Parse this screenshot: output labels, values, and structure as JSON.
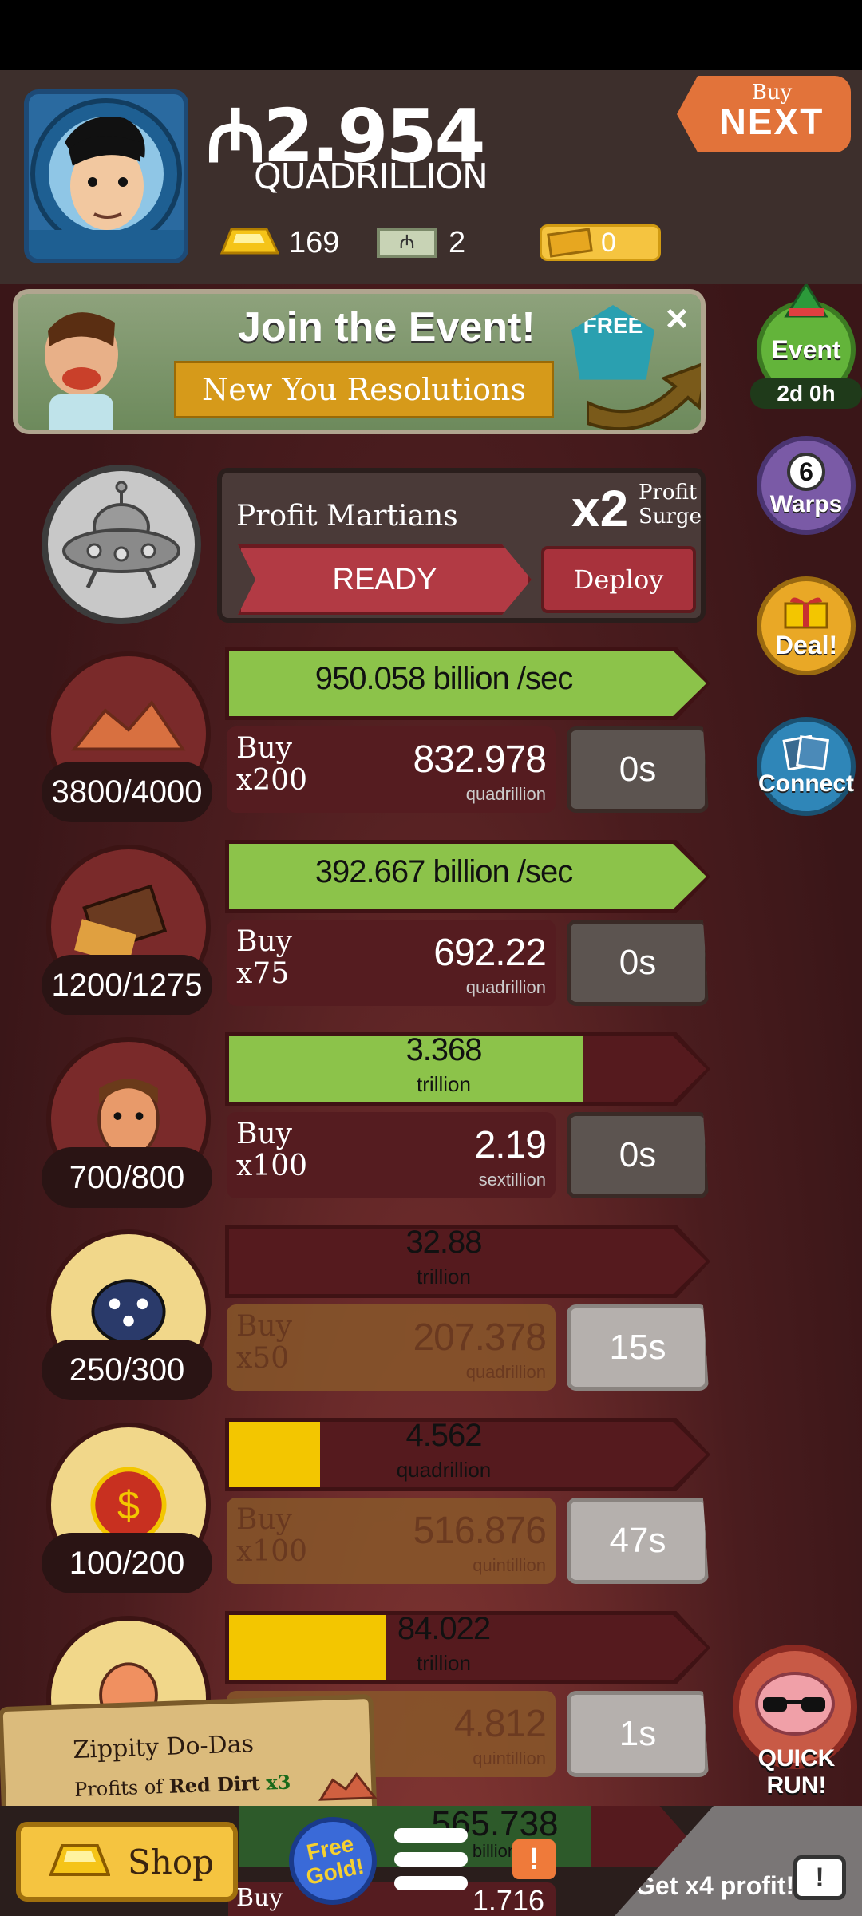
{
  "header": {
    "money_symbol": "₼",
    "money_value": "2.954",
    "money_unit": "QUADRILLION",
    "gold_count": "169",
    "megabucks_count": "2",
    "tickets_count": "0",
    "buy_next_top": "Buy",
    "buy_next_bottom": "NEXT"
  },
  "event_banner": {
    "title": "Join the Event!",
    "subtitle": "New You Resolutions",
    "free_label": "FREE"
  },
  "side_buttons": {
    "event_label": "Event",
    "event_time": "2d 0h",
    "warps_count": "6",
    "warps_label": "Warps",
    "deal_label": "Deal!",
    "connect_label": "Connect",
    "quick_run_label": "QUICK RUN!"
  },
  "martians": {
    "title": "Profit Martians",
    "multiplier": "x2",
    "surge_line1": "Profit",
    "surge_line2": "Surge",
    "ready_label": "READY",
    "deploy_label": "Deploy"
  },
  "businesses": [
    {
      "count": "3800/4000",
      "rate": "950.058 billion /sec",
      "rate_unit": "",
      "fill": 1.0,
      "fill_color": "#8cc34a",
      "buy_label": "Buy",
      "buy_qty": "x200",
      "cost": "832.978",
      "cost_unit": "quadrillion",
      "timer": "0s",
      "affordable": true
    },
    {
      "count": "1200/1275",
      "rate": "392.667 billion /sec",
      "rate_unit": "",
      "fill": 1.0,
      "fill_color": "#8cc34a",
      "buy_label": "Buy",
      "buy_qty": "x75",
      "cost": "692.22",
      "cost_unit": "quadrillion",
      "timer": "0s",
      "affordable": true
    },
    {
      "count": "700/800",
      "rate": "3.368",
      "rate_unit": "trillion",
      "fill": 0.74,
      "fill_color": "#8cc34a",
      "buy_label": "Buy",
      "buy_qty": "x100",
      "cost": "2.19",
      "cost_unit": "sextillion",
      "timer": "0s",
      "affordable": true
    },
    {
      "count": "250/300",
      "rate": "32.88",
      "rate_unit": "trillion",
      "fill": 0.0,
      "fill_color": "#f3c600",
      "buy_label": "Buy",
      "buy_qty": "x50",
      "cost": "207.378",
      "cost_unit": "quadrillion",
      "timer": "15s",
      "affordable": false
    },
    {
      "count": "100/200",
      "rate": "4.562",
      "rate_unit": "quadrillion",
      "fill": 0.19,
      "fill_color": "#f3c600",
      "buy_label": "Buy",
      "buy_qty": "x100",
      "cost": "516.876",
      "cost_unit": "quintillion",
      "timer": "47s",
      "affordable": false
    },
    {
      "count": "",
      "rate": "84.022",
      "rate_unit": "trillion",
      "fill": 0.33,
      "fill_color": "#f3c600",
      "buy_label": "",
      "buy_qty": "",
      "cost": "4.812",
      "cost_unit": "quintillion",
      "timer": "1s",
      "affordable": false
    }
  ],
  "toast": {
    "title": "Zippity Do-Das",
    "line_prefix": "Profits of",
    "line_bold": "Red Dirt",
    "line_mult": "x3"
  },
  "bottom": {
    "shop_label": "Shop",
    "free_gold_line1": "Free",
    "free_gold_line2": "Gold!",
    "partial_value": "565.738",
    "partial_unit": "billion",
    "partial_value2": "1.716",
    "partial_buy": "Buy",
    "get_profit_label": "Get x4 profit!"
  }
}
